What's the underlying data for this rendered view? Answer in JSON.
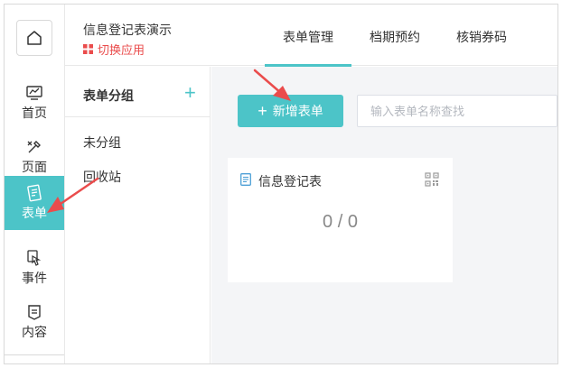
{
  "app": {
    "title": "信息登记表演示",
    "switch_label": "切换应用"
  },
  "rail": {
    "items": [
      {
        "label": "首页",
        "icon": "monitor-icon"
      },
      {
        "label": "页面",
        "icon": "brush-icon"
      },
      {
        "label": "表单",
        "icon": "form-icon"
      },
      {
        "label": "事件",
        "icon": "touch-icon"
      },
      {
        "label": "内容",
        "icon": "content-icon"
      }
    ],
    "active": "表单"
  },
  "tabs": [
    {
      "label": "表单管理",
      "active": true
    },
    {
      "label": "档期预约",
      "active": false
    },
    {
      "label": "核销券码",
      "active": false
    }
  ],
  "groups": {
    "title": "表单分组",
    "add": "+",
    "items": [
      "未分组",
      "回收站"
    ]
  },
  "toolbar": {
    "add_label": "新增表单",
    "add_icon": "+",
    "search_placeholder": "输入表单名称查找"
  },
  "cards": [
    {
      "title": "信息登记表",
      "count": "0 / 0"
    }
  ],
  "colors": {
    "accent": "#4cc4c8",
    "danger": "#ea4c4c",
    "annotation": "#ea4c4c"
  }
}
